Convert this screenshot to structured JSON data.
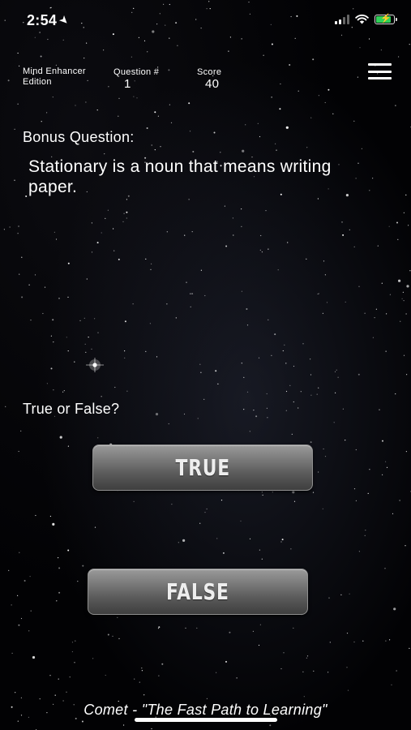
{
  "status_bar": {
    "time": "2:54",
    "location_icon": "location-arrow-icon",
    "signal_icon": "cellular-signal-icon",
    "wifi_icon": "wifi-icon",
    "battery_icon": "battery-charging-icon"
  },
  "header": {
    "edition_line1": "Mind Enhancer",
    "edition_line2": "Edition",
    "question_label": "Question #",
    "question_number": "1",
    "score_label": "Score",
    "score_value": "40",
    "menu_icon": "hamburger-menu-icon"
  },
  "question": {
    "type_label": "Bonus Question:",
    "text": "Stationary is a noun that means writing paper.",
    "prompt": "True or False?"
  },
  "answers": {
    "true_label": "TRUE",
    "false_label": "FALSE"
  },
  "footer": {
    "tagline": "Comet - \"The Fast Path to Learning\""
  },
  "colors": {
    "background": "#020204",
    "text": "#ffffff",
    "button_top": "#9a9a9a",
    "button_bottom": "#3e3e3e",
    "battery_fill": "#2fd158"
  }
}
